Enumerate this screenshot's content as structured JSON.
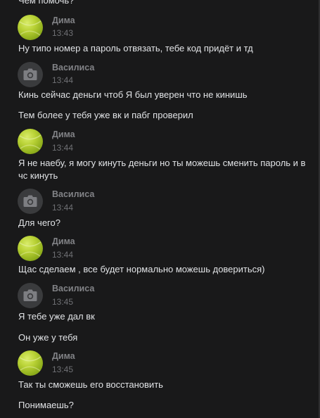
{
  "header": {
    "cut_text": "Чем помочь?"
  },
  "messages": [
    {
      "author": "Дима",
      "time": "13:43",
      "avatar": "tennis-ball-avatar",
      "texts": [
        "Ну типо номер а пароль отвязать, тебе код придёт и тд"
      ]
    },
    {
      "author": "Василиса",
      "time": "13:44",
      "avatar": "camera-icon",
      "texts": [
        "Кинь сейчас деньги чтоб Я был уверен что не кинишь",
        "Тем более у тебя уже вк и пабг проверил"
      ]
    },
    {
      "author": "Дима",
      "time": "13:44",
      "avatar": "tennis-ball-avatar",
      "texts": [
        "Я не наебу, я могу кинуть деньги но ты можешь сменить пароль и в чс кинуть"
      ]
    },
    {
      "author": "Василиса",
      "time": "13:44",
      "avatar": "camera-icon",
      "texts": [
        "Для чего?"
      ]
    },
    {
      "author": "Дима",
      "time": "13:44",
      "avatar": "tennis-ball-avatar",
      "texts": [
        "Щас сделаем , все будет нормально можешь довериться)"
      ]
    },
    {
      "author": "Василиса",
      "time": "13:45",
      "avatar": "camera-icon",
      "texts": [
        "Я тебе уже дал вк",
        "Он уже у тебя"
      ]
    },
    {
      "author": "Дима",
      "time": "13:45",
      "avatar": "tennis-ball-avatar",
      "texts": [
        "Так ты сможешь его восстановить",
        "Понимаешь?"
      ]
    }
  ]
}
